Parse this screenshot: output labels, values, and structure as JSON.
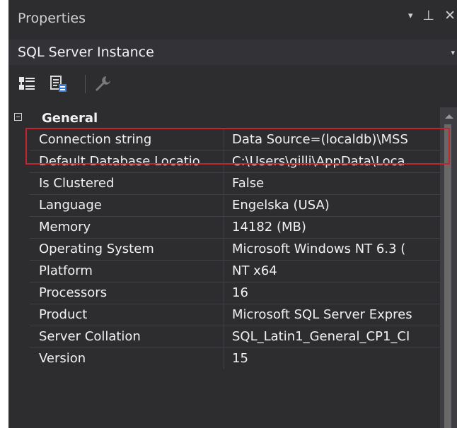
{
  "panel": {
    "title": "Properties",
    "controls": {
      "dropdown": "▾",
      "pin": "⊥",
      "close": "✕"
    }
  },
  "object_selector": {
    "selected": "SQL Server Instance",
    "chevron": "▾"
  },
  "toolbar": {
    "icons": [
      "categorized-icon",
      "property-pages-icon",
      "wrench-icon"
    ]
  },
  "grid": {
    "category": "General",
    "properties": [
      {
        "name": "Connection string",
        "value": "Data Source=(localdb)\\MSS"
      },
      {
        "name": "Default Database Locatio",
        "value": "C:\\Users\\gilli\\AppData\\Loca"
      },
      {
        "name": "Is Clustered",
        "value": "False"
      },
      {
        "name": "Language",
        "value": "Engelska (USA)"
      },
      {
        "name": "Memory",
        "value": "14182 (MB)"
      },
      {
        "name": "Operating System",
        "value": "Microsoft Windows NT 6.3 ("
      },
      {
        "name": "Platform",
        "value": "NT x64"
      },
      {
        "name": "Processors",
        "value": "16"
      },
      {
        "name": "Product",
        "value": "Microsoft SQL Server Expres"
      },
      {
        "name": "Server Collation",
        "value": "SQL_Latin1_General_CP1_CI"
      },
      {
        "name": "Version",
        "value": "15"
      }
    ]
  },
  "colors": {
    "background": "#2d2d30",
    "text": "#f1f1f1",
    "highlight": "#c0272d"
  }
}
